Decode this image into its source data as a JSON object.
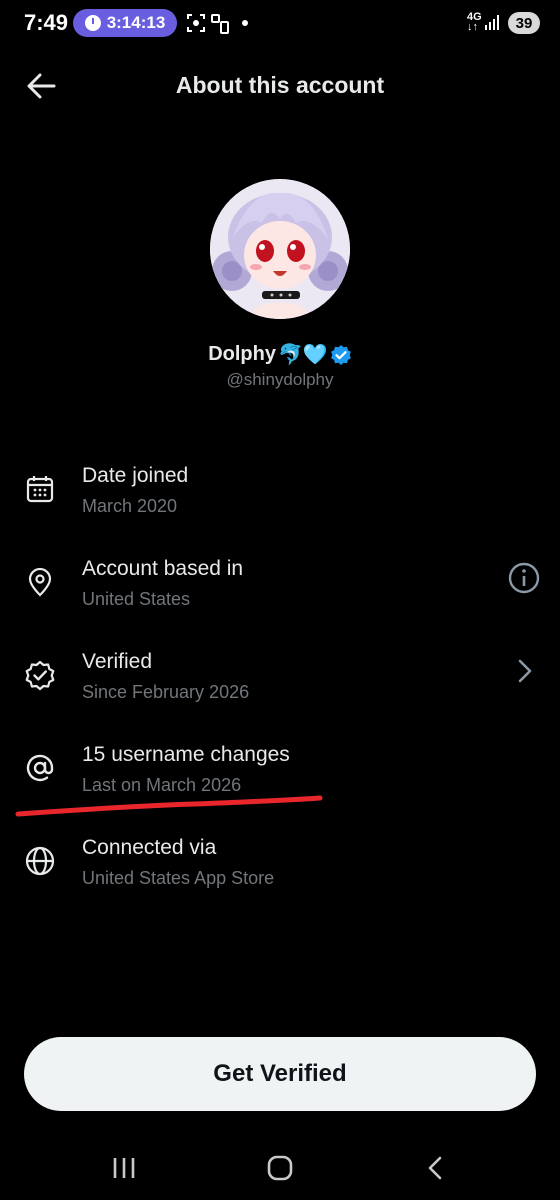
{
  "status_bar": {
    "time": "7:49",
    "timer": "3:14:13",
    "network": "4G",
    "battery": "39"
  },
  "header": {
    "back_icon": "arrow-left-icon",
    "title": "About this account"
  },
  "profile": {
    "avatar_icon": "anime-girl-avatar",
    "display_name": "Dolphy",
    "name_emoji": "🐬🩵",
    "verified_badge_color": "#1d9bf0",
    "handle": "@shinydolphy"
  },
  "info_rows": [
    {
      "icon": "calendar-icon",
      "title": "Date joined",
      "subtitle": "March 2020"
    },
    {
      "icon": "location-pin-icon",
      "title": "Account based in",
      "subtitle": "United States",
      "action_icon": "info-icon"
    },
    {
      "icon": "verified-badge-icon",
      "title": "Verified",
      "subtitle": "Since February 2026",
      "action_icon": "chevron-right-icon"
    },
    {
      "icon": "at-sign-icon",
      "title": "15 username changes",
      "subtitle": "Last on March 2026"
    },
    {
      "icon": "globe-icon",
      "title": "Connected via",
      "subtitle": "United States App Store"
    }
  ],
  "annotation": {
    "underline_color": "#e8262c"
  },
  "cta": {
    "label": "Get Verified"
  },
  "nav_bar": [
    "recents-icon",
    "home-icon",
    "back-icon"
  ],
  "colors": {
    "background": "#000000",
    "primary_text": "#e7e9ea",
    "secondary_text": "#71767b",
    "timer_pill": "#6a5ee0",
    "button_bg": "#eff3f4"
  }
}
